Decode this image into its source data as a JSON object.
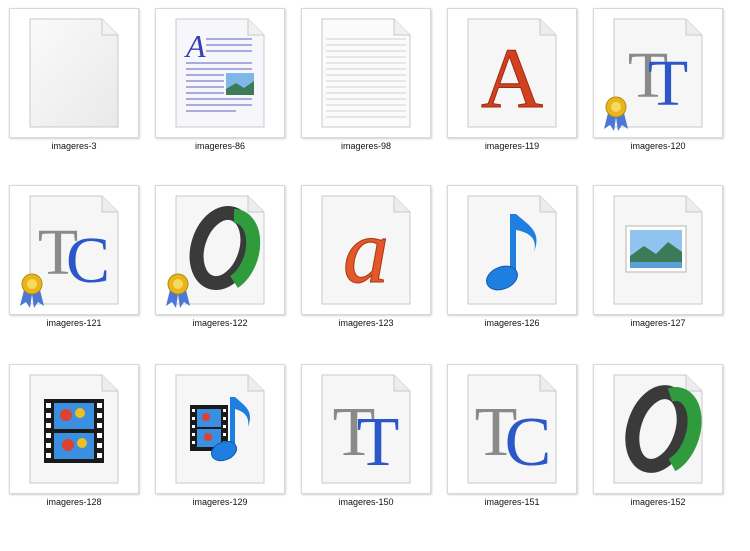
{
  "files": [
    {
      "name": "imageres-3",
      "icon": "blank-document-icon"
    },
    {
      "name": "imageres-86",
      "icon": "rich-text-document-icon"
    },
    {
      "name": "imageres-98",
      "icon": "lined-text-document-icon"
    },
    {
      "name": "imageres-119",
      "icon": "font-file-A-icon"
    },
    {
      "name": "imageres-120",
      "icon": "truetype-certified-font-icon"
    },
    {
      "name": "imageres-121",
      "icon": "truetype-collection-certified-icon"
    },
    {
      "name": "imageres-122",
      "icon": "opentype-certified-font-icon"
    },
    {
      "name": "imageres-123",
      "icon": "font-file-a-icon"
    },
    {
      "name": "imageres-126",
      "icon": "music-note-file-icon"
    },
    {
      "name": "imageres-127",
      "icon": "image-file-icon"
    },
    {
      "name": "imageres-128",
      "icon": "video-file-icon"
    },
    {
      "name": "imageres-129",
      "icon": "video-audio-file-icon"
    },
    {
      "name": "imageres-150",
      "icon": "truetype-font-icon"
    },
    {
      "name": "imageres-151",
      "icon": "truetype-collection-icon"
    },
    {
      "name": "imageres-152",
      "icon": "opentype-font-icon"
    }
  ],
  "colors": {
    "font_red": "#d2401f",
    "font_blue": "#2b57c8",
    "font_gray": "#8a8a8a",
    "music_blue": "#1f7fe0",
    "award_gold": "#e8b61a"
  }
}
